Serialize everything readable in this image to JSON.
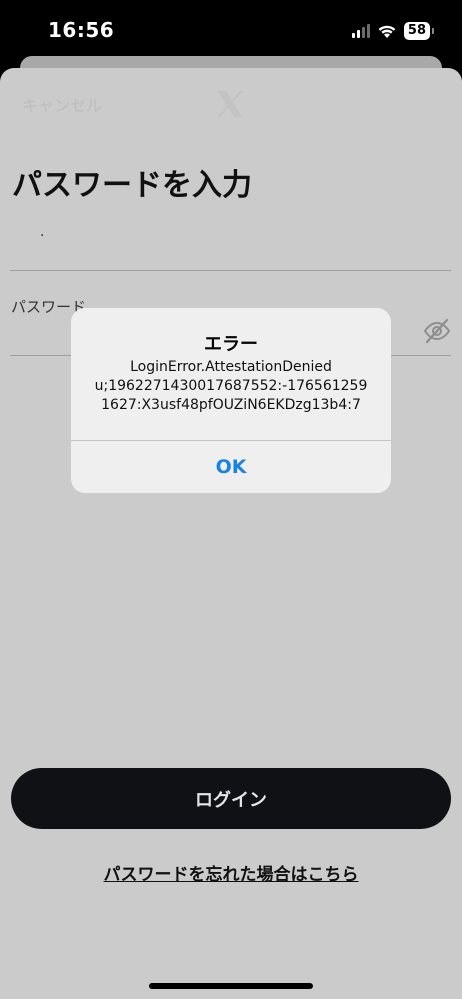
{
  "status_bar": {
    "time": "16:56",
    "battery": "58"
  },
  "sheet": {
    "cancel_label": "キャンセル",
    "title": "パスワードを入力",
    "username_value": "·",
    "password_label": "パスワード",
    "eye_icon": "eye-slash-icon"
  },
  "alert": {
    "title": "エラー",
    "message": "LoginError.AttestationDenied\nu;1962271430017687552:-176561259\n1627:X3usf48pfOUZiN6EKDzg13b4:7",
    "ok_label": "OK"
  },
  "actions": {
    "login_label": "ログイン",
    "forgot_label": "パスワードを忘れた場合はこちら"
  },
  "colors": {
    "sheet_background": "#cbcbcb",
    "alert_background": "#efefef",
    "accent_blue": "#1a82e0",
    "button_dark": "#0f1114"
  }
}
